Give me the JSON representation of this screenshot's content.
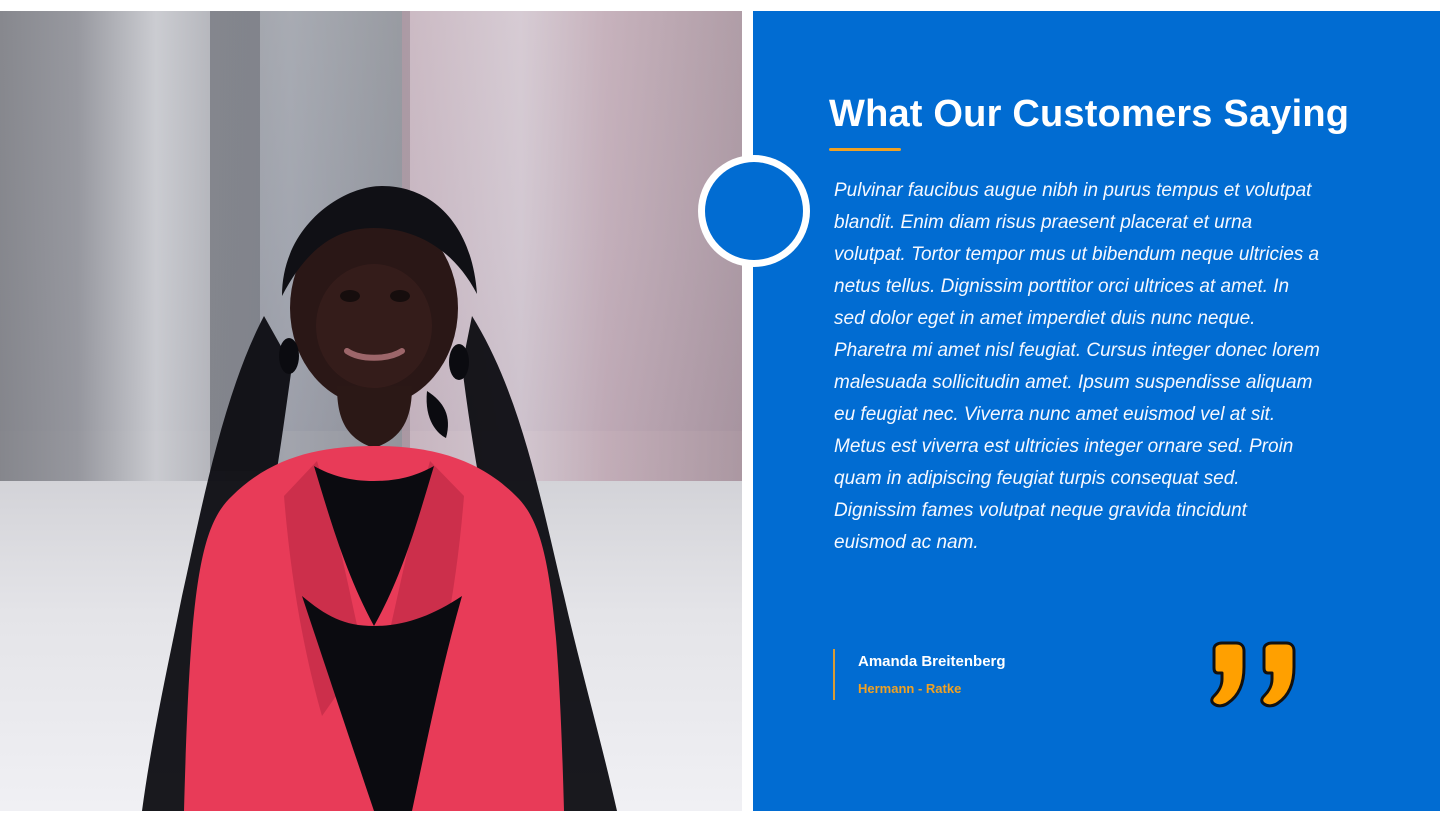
{
  "testimonial": {
    "title": "What Our Customers Saying",
    "quote": "Pulvinar faucibus augue nibh in purus tempus et volutpat blandit. Enim diam risus praesent placerat et urna volutpat. Tortor tempor mus ut bibendum neque ultricies a netus tellus. Dignissim porttitor orci ultrices at amet. In sed dolor eget in amet imperdiet duis nunc neque. Pharetra mi amet nisl feugiat. Cursus integer donec lorem malesuada sollicitudin amet. Ipsum suspendisse aliquam eu feugiat nec. Viverra nunc amet euismod vel at sit. Metus est viverra est ultricies integer ornare sed. Proin quam in adipiscing feugiat turpis consequat sed. Dignissim fames volutpat neque gravida tincidunt euismod ac nam.",
    "author_name": "Amanda Breitenberg",
    "author_company": "Hermann - Ratke"
  },
  "icons": {
    "quote": "closing-quote-icon"
  },
  "colors": {
    "panel_blue": "#016cd2",
    "accent_orange": "#f0a123",
    "white": "#ffffff",
    "photo_jacket_red": "#e83b58",
    "photo_top_black": "#0b0b10"
  }
}
